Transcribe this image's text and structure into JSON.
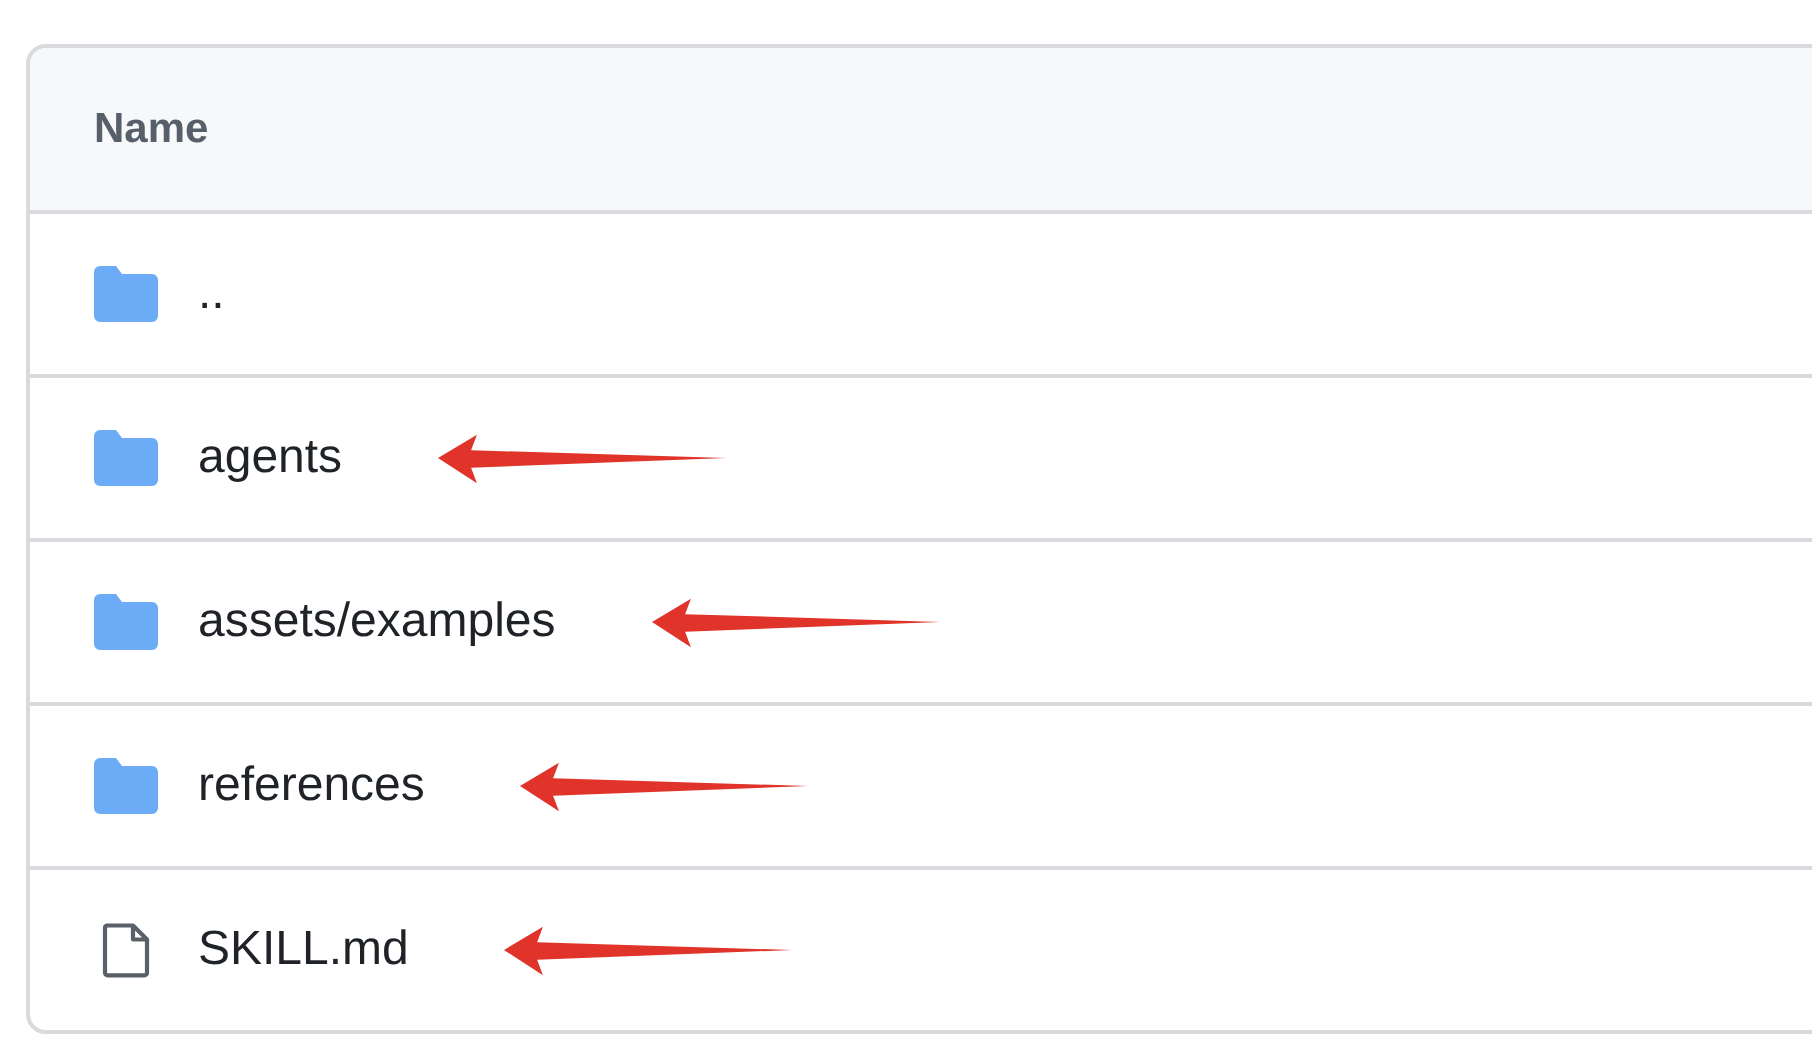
{
  "table": {
    "columns": [
      "Name"
    ],
    "rows": [
      {
        "kind": "folder",
        "name": "..",
        "annotated": false
      },
      {
        "kind": "folder",
        "name": "agents",
        "annotated": true
      },
      {
        "kind": "folder",
        "name": "assets/examples",
        "annotated": true
      },
      {
        "kind": "folder",
        "name": "references",
        "annotated": true
      },
      {
        "kind": "file",
        "name": "SKILL.md",
        "annotated": true
      }
    ]
  }
}
